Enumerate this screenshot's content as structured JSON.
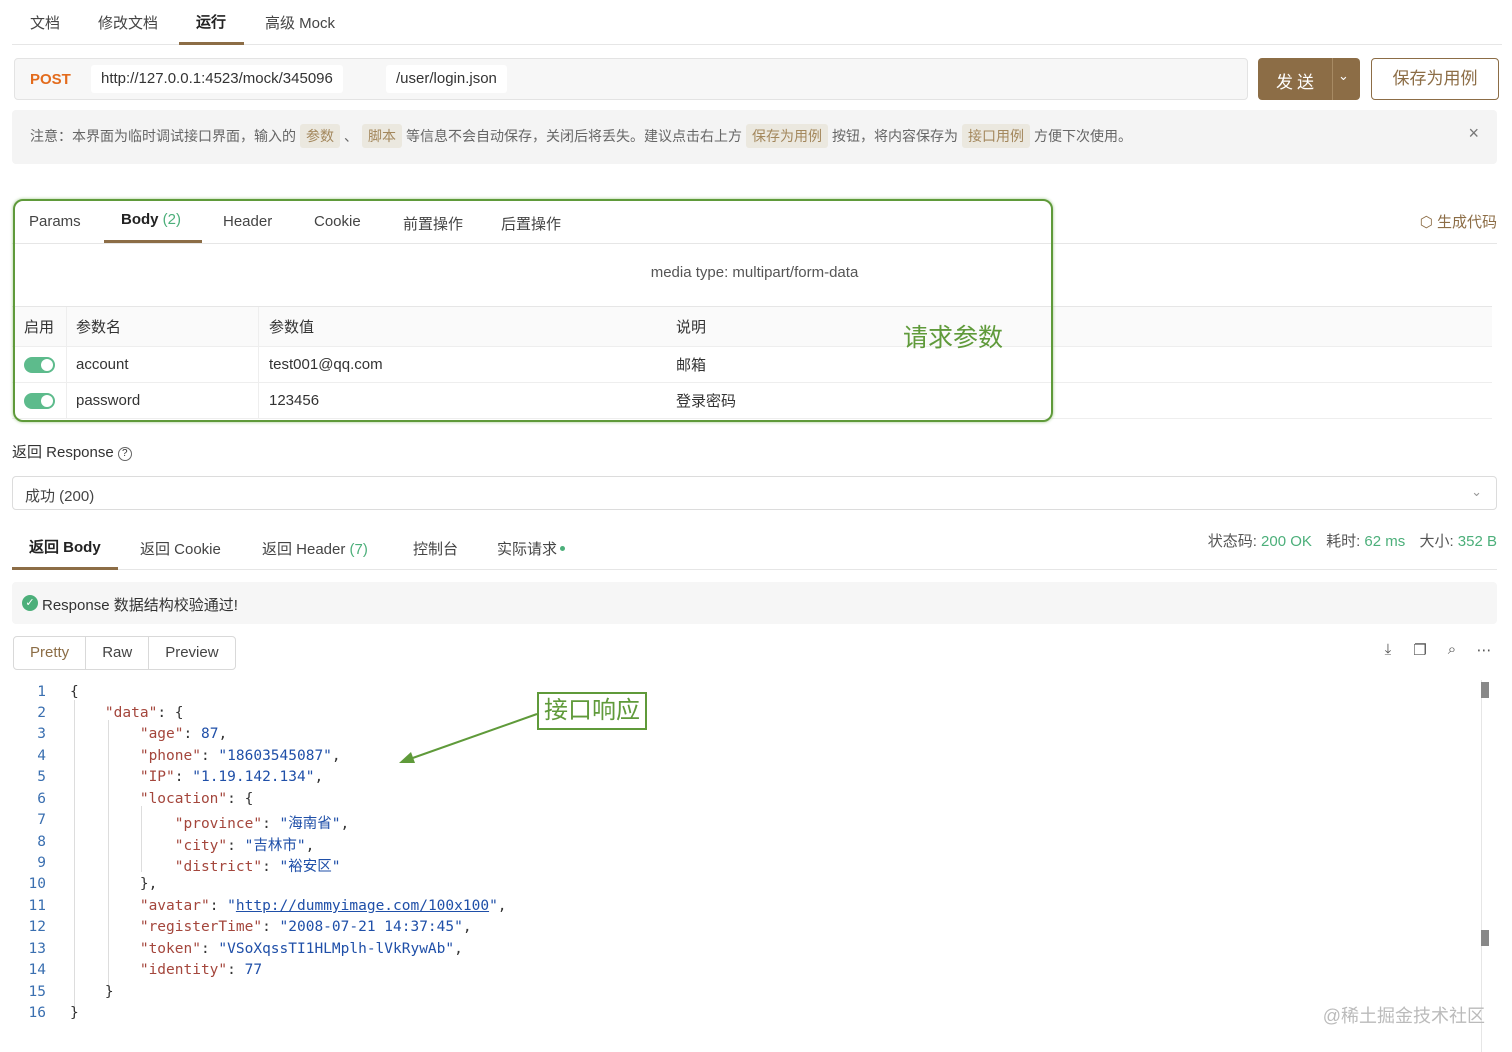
{
  "top_tabs": [
    "文档",
    "修改文档",
    "运行",
    "高级 Mock"
  ],
  "request": {
    "method": "POST",
    "base_url": "http://127.0.0.1:4523/mock/345096",
    "path": "/user/login.json",
    "send_label": "发送",
    "save_label": "保存为用例"
  },
  "notice": {
    "prefix": "注意：本界面为临时调试接口界面，输入的",
    "tag1": "参数",
    "sep": "、",
    "tag2": "脚本",
    "mid1": "等信息不会自动保存，关闭后将丢失。建议点击右上方",
    "tag3": "保存为用例",
    "mid2": "按钮，将内容保存为",
    "tag4": "接口用例",
    "suffix": "方便下次使用。",
    "close": "×"
  },
  "req_tabs": {
    "params": "Params",
    "body": "Body",
    "body_count": "(2)",
    "header": "Header",
    "cookie": "Cookie",
    "pre": "前置操作",
    "post": "后置操作",
    "gen_code": "生成代码"
  },
  "media_type": "media type: multipart/form-data",
  "param_table": {
    "headers": [
      "启用",
      "参数名",
      "参数值",
      "说明"
    ],
    "rows": [
      {
        "name": "account",
        "value": "test001@qq.com",
        "desc": "邮箱"
      },
      {
        "name": "password",
        "value": "123456",
        "desc": "登录密码"
      }
    ]
  },
  "annotations": {
    "request_params": "请求参数",
    "api_response": "接口响应"
  },
  "response": {
    "title": "返回 Response",
    "help": "?",
    "selected": "成功 (200)",
    "tabs": {
      "body": "返回 Body",
      "cookie": "返回 Cookie",
      "header": "返回 Header",
      "header_count": "(7)",
      "console": "控制台",
      "actual": "实际请求"
    },
    "stats": {
      "status_label": "状态码:",
      "status": "200 OK",
      "time_label": "耗时:",
      "time": "62 ms",
      "size_label": "大小:",
      "size": "352 B"
    },
    "validation": "Response 数据结构校验通过!",
    "formats": [
      "Pretty",
      "Raw",
      "Preview"
    ]
  },
  "code_lines": [
    "1",
    "2",
    "3",
    "4",
    "5",
    "6",
    "7",
    "8",
    "9",
    "10",
    "11",
    "12",
    "13",
    "14",
    "15",
    "16"
  ],
  "json": {
    "age": "87",
    "phone": "\"18603545087\"",
    "ip": "\"1.19.142.134\"",
    "province": "\"海南省\"",
    "city": "\"吉林市\"",
    "district": "\"裕安区\"",
    "avatar": "http://dummyimage.com/100x100",
    "registerTime": "\"2008-07-21 14:37:45\"",
    "token": "\"VSoXqssTI1HLMplh-lVkRywAb\"",
    "identity": "77"
  },
  "watermark": "@稀土掘金技术社区",
  "colors": {
    "accent": "#8c6d46",
    "success": "#4caf7a",
    "method": "#e36b1c",
    "annotation": "#5f9a3a"
  }
}
